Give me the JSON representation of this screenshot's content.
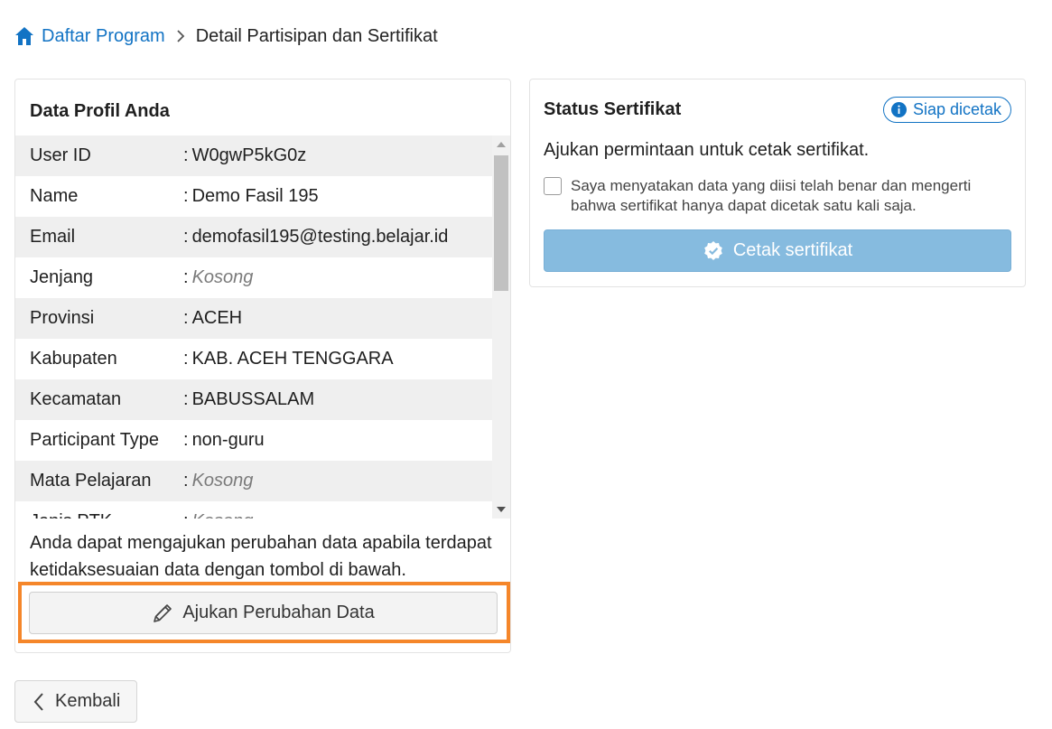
{
  "breadcrumb": {
    "home_icon": "home-icon",
    "link": "Daftar Program",
    "current": "Detail Partisipan dan Sertifikat"
  },
  "profile": {
    "title": "Data Profil Anda",
    "colon": ":",
    "rows": [
      {
        "key": "User ID",
        "value": "W0gwP5kG0z",
        "empty": false
      },
      {
        "key": "Name",
        "value": "Demo Fasil 195",
        "empty": false
      },
      {
        "key": "Email",
        "value": "demofasil195@testing.belajar.id",
        "empty": false
      },
      {
        "key": "Jenjang",
        "value": "Kosong",
        "empty": true
      },
      {
        "key": "Provinsi",
        "value": "ACEH",
        "empty": false
      },
      {
        "key": "Kabupaten",
        "value": "KAB. ACEH TENGGARA",
        "empty": false
      },
      {
        "key": "Kecamatan",
        "value": "BABUSSALAM",
        "empty": false
      },
      {
        "key": "Participant Type",
        "value": "non-guru",
        "empty": false
      },
      {
        "key": "Mata Pelajaran",
        "value": "Kosong",
        "empty": true
      },
      {
        "key": "Jenis PTK",
        "value": "Kosong",
        "empty": true
      }
    ],
    "hint": "Anda dapat mengajukan perubahan data apabila terdapat ketidaksesuaian data dengan tombol di bawah.",
    "edit_button": "Ajukan Perubahan Data",
    "edit_icon": "pencil-icon",
    "highlight_color": "#f5862a"
  },
  "status": {
    "title": "Status Sertifikat",
    "badge": "Siap dicetak",
    "badge_icon": "info-icon",
    "description": "Ajukan permintaan untuk cetak sertifikat.",
    "agree_text": "Saya menyatakan data yang diisi telah benar dan mengerti bahwa sertifikat hanya dapat dicetak satu kali saja.",
    "agree_checked": false,
    "print_button": "Cetak sertifikat",
    "print_icon": "verified-badge-icon",
    "print_enabled": false
  },
  "back_button": "Kembali",
  "colors": {
    "link": "#1273c4",
    "print_button_disabled": "#86bbdf",
    "row_stripe": "#efefef"
  }
}
